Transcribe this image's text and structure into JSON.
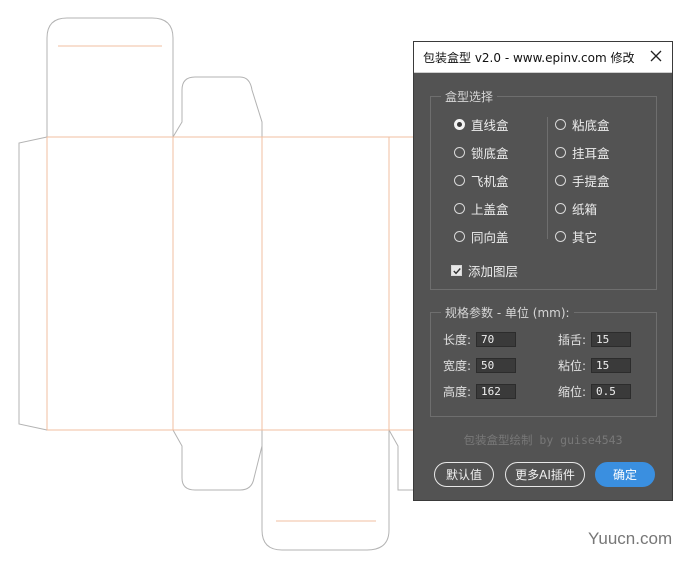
{
  "window": {
    "title": "包装盒型 v2.0 - www.epinv.com 修改"
  },
  "box_type": {
    "label": "盒型选择",
    "options_left": [
      "直线盒",
      "锁底盒",
      "飞机盒",
      "上盖盒",
      "同向盖"
    ],
    "options_right": [
      "粘底盒",
      "挂耳盒",
      "手提盒",
      "纸箱",
      "其它"
    ],
    "selected": "直线盒",
    "add_layer_label": "添加图层",
    "add_layer_checked": true
  },
  "params": {
    "label": "规格参数 - 单位 (mm):",
    "length_label": "长度:",
    "length_value": "70",
    "tuck_label": "插舌:",
    "tuck_value": "15",
    "width_label": "宽度:",
    "width_value": "50",
    "glue_label": "粘位:",
    "glue_value": "15",
    "height_label": "高度:",
    "height_value": "162",
    "shrink_label": "缩位:",
    "shrink_value": "0.5"
  },
  "credit": "包装盒型绘制 by guise4543",
  "buttons": {
    "default": "默认值",
    "more_plugins": "更多AI插件",
    "ok": "确定"
  },
  "watermark": "Yuucn.com",
  "colors": {
    "panel_bg": "#535353",
    "primary_button": "#3a8fe0",
    "cut_line": "#b3b3b3",
    "fold_line": "#f2bfa0"
  }
}
